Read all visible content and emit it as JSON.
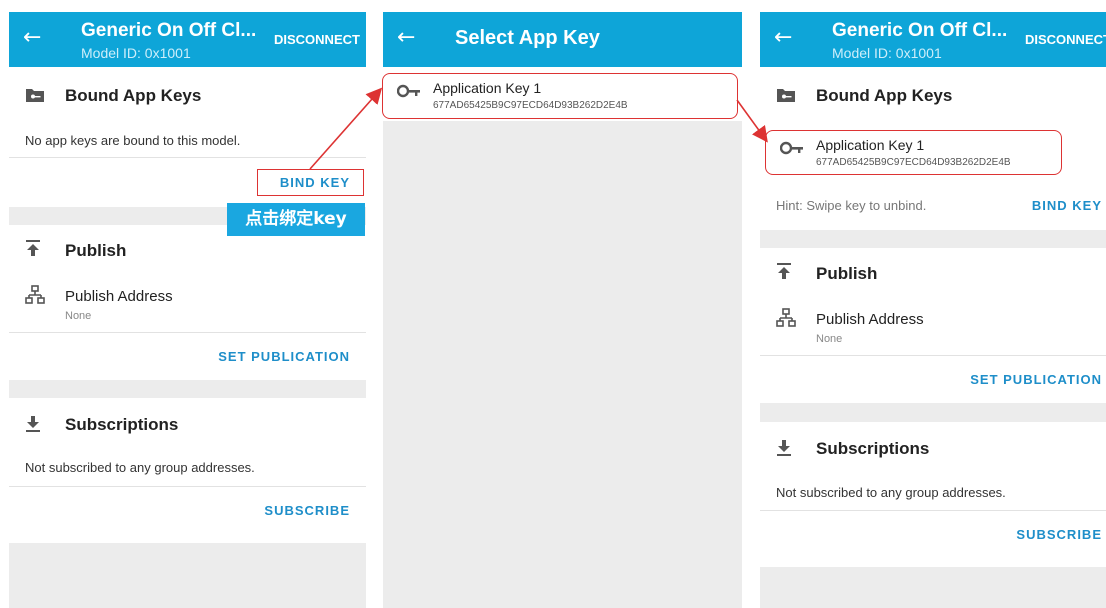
{
  "panel_left": {
    "appbar": {
      "back": "←",
      "title": "Generic On Off Cl...",
      "subtitle": "Model ID: 0x1001",
      "action": "DISCONNECT"
    },
    "bound": {
      "title": "Bound App Keys",
      "empty_text": "No app keys are bound to this model.",
      "action": "BIND KEY"
    },
    "callout": "点击绑定key",
    "publish": {
      "title": "Publish",
      "address_label": "Publish Address",
      "address_value": "None",
      "action": "SET PUBLICATION"
    },
    "subscriptions": {
      "title": "Subscriptions",
      "empty_text": "Not subscribed to any group addresses.",
      "action": "SUBSCRIBE"
    }
  },
  "panel_middle": {
    "appbar": {
      "back": "←",
      "title": "Select App Key"
    },
    "keys": [
      {
        "name": "Application Key 1",
        "value": "677AD65425B9C97ECD64D93B262D2E4B"
      }
    ]
  },
  "panel_right": {
    "appbar": {
      "back": "←",
      "title": "Generic On Off Cl...",
      "subtitle": "Model ID: 0x1001",
      "action": "DISCONNECT"
    },
    "bound": {
      "title": "Bound App Keys",
      "key_name": "Application Key 1",
      "key_value": "677AD65425B9C97ECD64D93B262D2E4B",
      "hint": "Hint: Swipe key to unbind.",
      "action": "BIND KEY"
    },
    "publish": {
      "title": "Publish",
      "address_label": "Publish Address",
      "address_value": "None",
      "action": "SET PUBLICATION"
    },
    "subscriptions": {
      "title": "Subscriptions",
      "empty_text": "Not subscribed to any group addresses.",
      "action": "SUBSCRIBE"
    }
  },
  "icons": {
    "back": "arrow-left-icon",
    "folder": "folder-key-icon",
    "key": "key-icon",
    "publish": "publish-icon",
    "network": "network-icon",
    "download": "download-icon"
  },
  "colors": {
    "appbar": "#0ea5d8",
    "accent": "#1e8ec9",
    "highlight": "#dd3333",
    "callout": "#1aa7e0"
  }
}
